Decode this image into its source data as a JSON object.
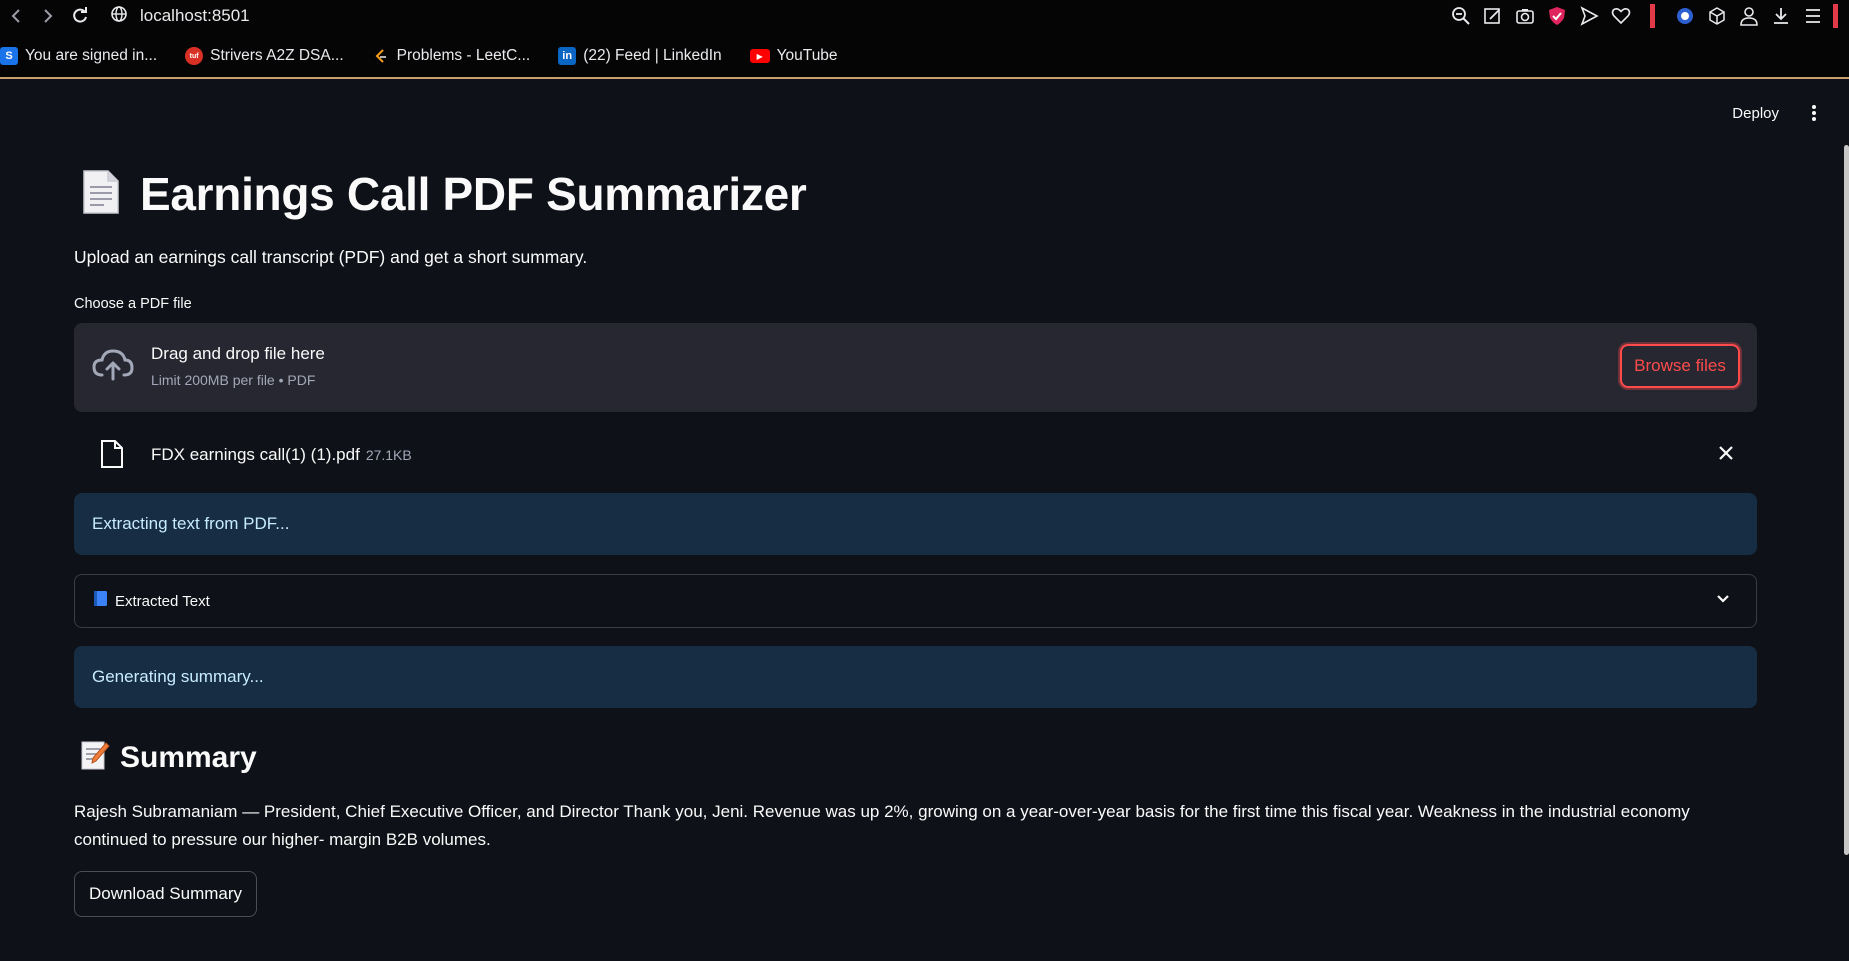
{
  "browser": {
    "url": "localhost:8501",
    "bookmarks": [
      {
        "label": "You are signed in...",
        "icon": "s-logo-icon",
        "color": "#1a73e8",
        "glyph": "S"
      },
      {
        "label": "Strivers A2Z DSA...",
        "icon": "tuf-logo-icon",
        "color": "#d93025",
        "glyph": "tuf"
      },
      {
        "label": "Problems - LeetC...",
        "icon": "leetcode-icon",
        "color": "#f89f1b",
        "glyph": ""
      },
      {
        "label": "(22) Feed | LinkedIn",
        "icon": "linkedin-icon",
        "color": "#0a66c2",
        "glyph": "in"
      },
      {
        "label": "YouTube",
        "icon": "youtube-icon",
        "color": "#ff0000",
        "glyph": "▶"
      }
    ]
  },
  "header": {
    "deploy_label": "Deploy"
  },
  "page": {
    "title_emoji": "📄",
    "title": "Earnings Call PDF Summarizer",
    "subtitle": "Upload an earnings call transcript (PDF) and get a short summary."
  },
  "uploader": {
    "label": "Choose a PDF file",
    "drag_text": "Drag and drop file here",
    "limit_text": "Limit 200MB per file • PDF",
    "browse_label": "Browse files",
    "file_name": "FDX earnings call(1) (1).pdf",
    "file_size": "27.1KB"
  },
  "status": {
    "extracting": "Extracting text from PDF...",
    "generating": "Generating summary..."
  },
  "expander": {
    "emoji": "📘",
    "label": "Extracted Text"
  },
  "summary": {
    "emoji": "📝",
    "heading": "Summary",
    "text": "Rajesh Subramaniam — President, Chief Executive Officer, and Director Thank you, Jeni. Revenue was up 2%, growing on a year-over-year basis for the first time this fiscal year. Weakness in the industrial economy continued to pressure our higher- margin B2B volumes.",
    "download_label": "Download Summary"
  },
  "colors": {
    "background": "#0e1117",
    "accent": "#ff4b4b",
    "info_bg": "#172d43",
    "info_text": "#c7ebff"
  }
}
